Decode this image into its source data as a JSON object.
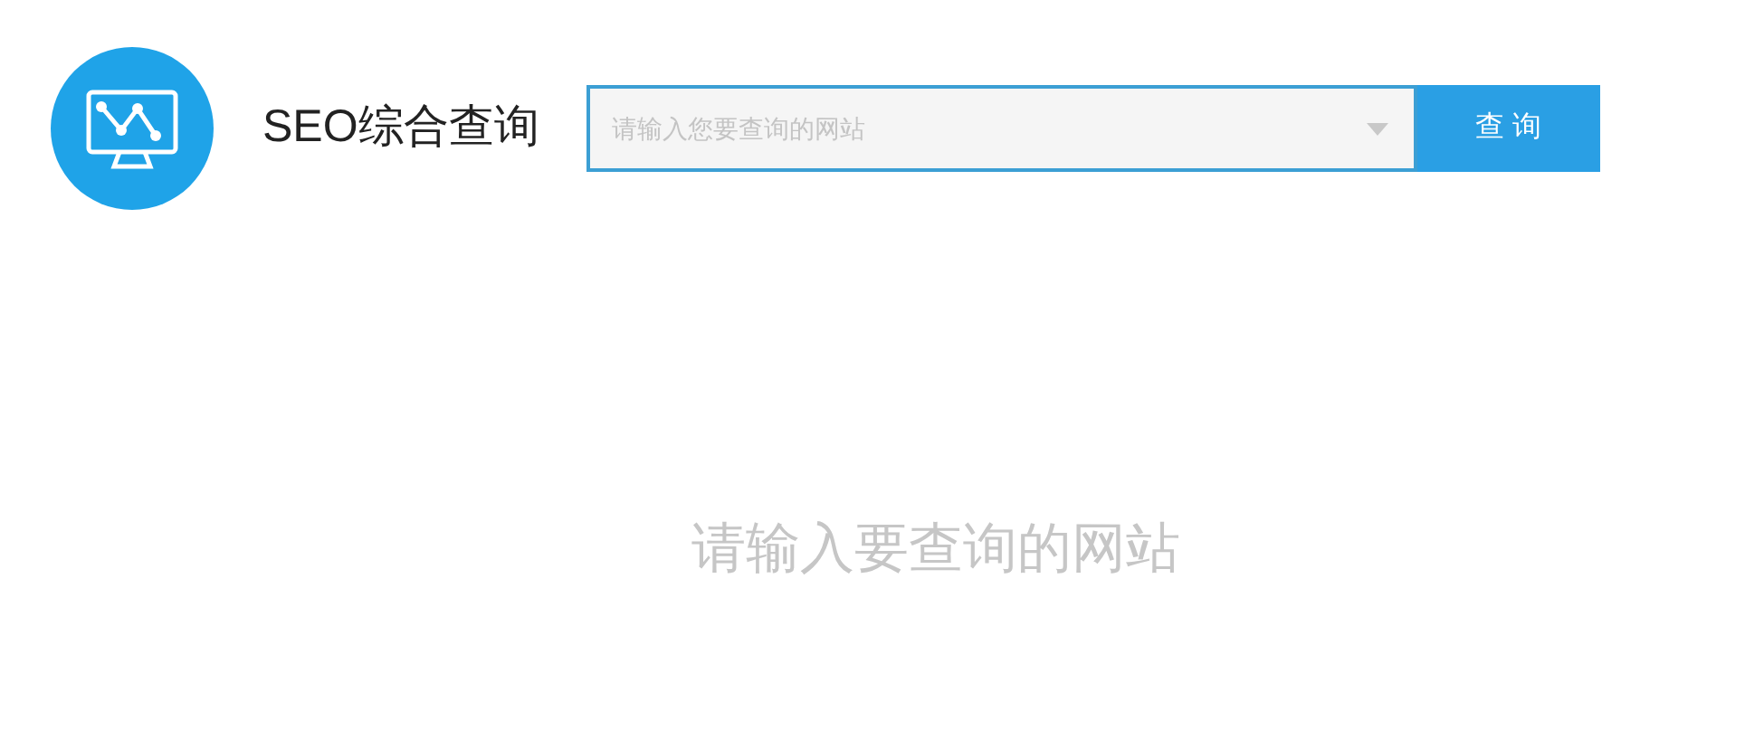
{
  "header": {
    "title": "SEO综合查询"
  },
  "search": {
    "placeholder": "请输入您要查询的网站",
    "button": "查 询"
  },
  "empty_message": "请输入要查询的网站"
}
